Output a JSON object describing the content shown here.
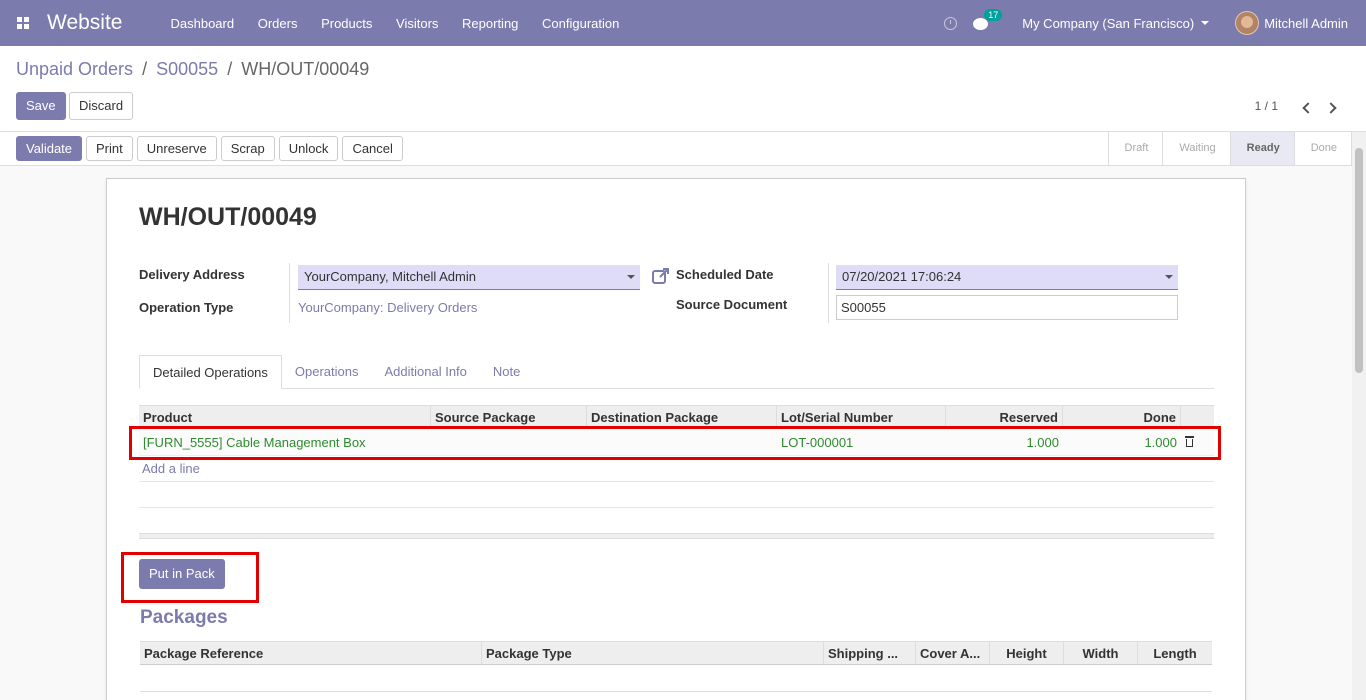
{
  "navbar": {
    "app_name": "Website",
    "menu": [
      "Dashboard",
      "Orders",
      "Products",
      "Visitors",
      "Reporting",
      "Configuration"
    ],
    "chat_count": "17",
    "company": "My Company (San Francisco)",
    "user": "Mitchell Admin"
  },
  "breadcrumb": {
    "items": [
      "Unpaid Orders",
      "S00055"
    ],
    "current": "WH/OUT/00049",
    "sep": "/"
  },
  "controls": {
    "save": "Save",
    "discard": "Discard",
    "pager": "1 / 1"
  },
  "actions": [
    "Validate",
    "Print",
    "Unreserve",
    "Scrap",
    "Unlock",
    "Cancel"
  ],
  "stages": [
    "Draft",
    "Waiting",
    "Ready",
    "Done"
  ],
  "active_stage": "Ready",
  "record": {
    "name": "WH/OUT/00049",
    "delivery_address_label": "Delivery Address",
    "delivery_address": "YourCompany, Mitchell Admin",
    "operation_type_label": "Operation Type",
    "operation_type": "YourCompany: Delivery Orders",
    "scheduled_date_label": "Scheduled Date",
    "scheduled_date": "07/20/2021 17:06:24",
    "source_document_label": "Source Document",
    "source_document": "S00055"
  },
  "tabs": [
    "Detailed Operations",
    "Operations",
    "Additional Info",
    "Note"
  ],
  "ops_table": {
    "headers": [
      "Product",
      "Source Package",
      "Destination Package",
      "Lot/Serial Number",
      "Reserved",
      "Done"
    ],
    "rows": [
      {
        "product": "[FURN_5555] Cable Management Box",
        "source_package": "",
        "destination_package": "",
        "lot": "LOT-000001",
        "reserved": "1.000",
        "done": "1.000"
      }
    ],
    "add_line": "Add a line"
  },
  "put_in_pack": "Put in Pack",
  "packages": {
    "title": "Packages",
    "headers": [
      "Package Reference",
      "Package Type",
      "Shipping ...",
      "Cover A...",
      "Height",
      "Width",
      "Length"
    ]
  },
  "colors": {
    "brand": "#7c7bad",
    "highlight": "#e00000",
    "row_text": "#2e8b2e"
  }
}
